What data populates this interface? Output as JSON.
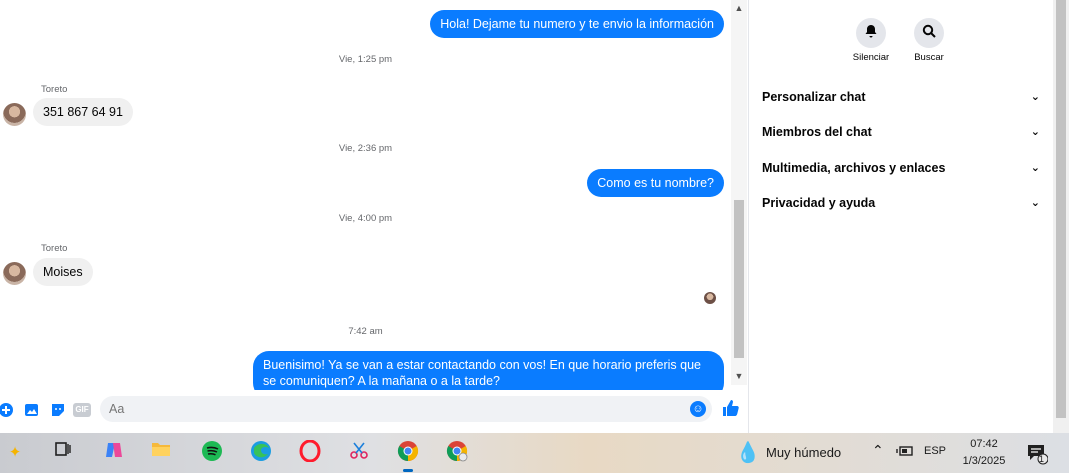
{
  "chat": {
    "messages": [
      {
        "kind": "out",
        "text": "Hola! Dejame tu numero y te envio la información"
      },
      {
        "kind": "stamp",
        "text": "Vie, 1:25 pm"
      },
      {
        "kind": "sender",
        "text": "Toreto"
      },
      {
        "kind": "in",
        "text": "351 867 64 91"
      },
      {
        "kind": "stamp",
        "text": "Vie, 2:36 pm"
      },
      {
        "kind": "out",
        "text": "Como es tu nombre?"
      },
      {
        "kind": "stamp",
        "text": "Vie, 4:00 pm"
      },
      {
        "kind": "sender",
        "text": "Toreto"
      },
      {
        "kind": "in",
        "text": "Moises"
      },
      {
        "kind": "stamp",
        "text": "7:42 am"
      },
      {
        "kind": "out",
        "text": "Buenisimo! Ya se van a estar contactando con vos! En que horario preferis que se comuniquen? A la mañana o a la tarde?"
      }
    ]
  },
  "composer": {
    "placeholder": "Aa",
    "gif_label": "GIF"
  },
  "panel": {
    "mute_label": "Silenciar",
    "search_label": "Buscar",
    "sections": [
      "Personalizar chat",
      "Miembros del chat",
      "Multimedia, archivos y enlaces",
      "Privacidad y ayuda"
    ]
  },
  "taskbar": {
    "weather": "Muy húmedo",
    "language": "ESP",
    "time": "07:42",
    "date": "1/3/2025",
    "notification_count": "1"
  },
  "colors": {
    "accent": "#0a7cff",
    "incoming_bubble": "#f0f0f0"
  }
}
